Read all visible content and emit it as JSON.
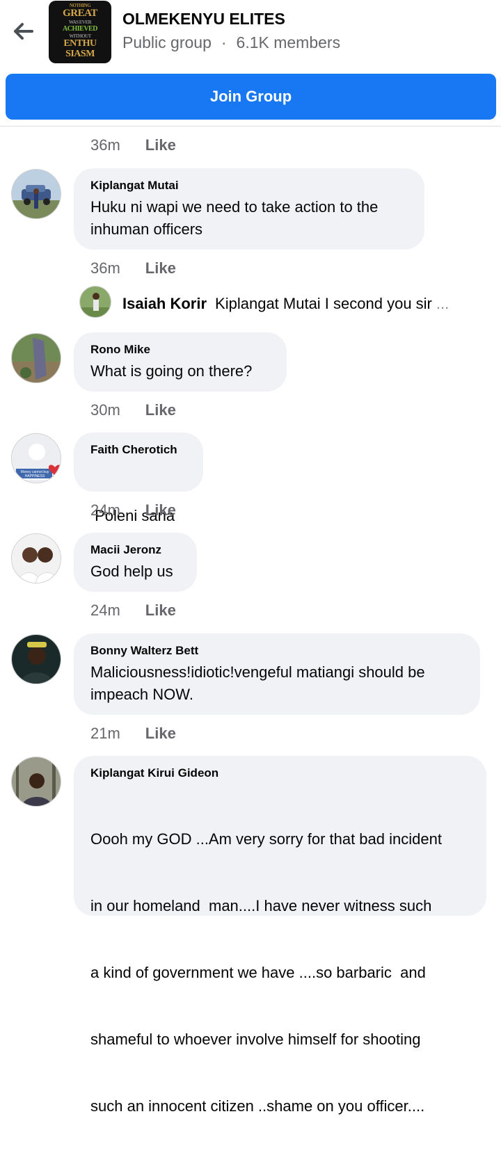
{
  "header": {
    "back_icon": "arrow-left-icon",
    "group_name": "OLMEKENYU ELITES",
    "privacy": "Public group",
    "separator": "·",
    "members": "6.1K members",
    "thumbnail_text": [
      "NOTHING",
      "GREAT",
      "WAS EVER",
      "ACHIEVED",
      "WITHOUT",
      "ENTHU",
      "SIASM"
    ]
  },
  "join_button": {
    "label": "Join Group",
    "color": "#1877f2"
  },
  "like_label": "Like",
  "top_meta": {
    "time": "36m"
  },
  "comments": [
    {
      "author": "Kiplangat Mutai",
      "lines": [
        "Huku ni wapi we need to take action to the",
        "inhuman officers"
      ],
      "time": "36m"
    },
    {
      "author": "Rono Mike",
      "lines": [
        "What is going on there?"
      ],
      "time": "30m"
    },
    {
      "author": "Faith Cherotich",
      "lines": [
        " Poleni sana"
      ],
      "time": "24m"
    },
    {
      "author": "Macii Jeronz",
      "lines": [
        "God help us"
      ],
      "time": "24m"
    },
    {
      "author": "Bonny Walterz Bett",
      "lines": [
        "Maliciousness!idiotic!vengeful matiangi should be",
        "impeach NOW."
      ],
      "time": "21m"
    },
    {
      "author": "Kiplangat Kirui Gideon",
      "lines": [
        "Oooh my GOD ...Am very sorry for that bad incident",
        "in our homeland  man....I have never witness such",
        "a kind of government we have ....so barbaric  and",
        "shameful to whoever involve himself for shooting",
        "such an innocent citizen ..shame on you officer...."
      ]
    }
  ],
  "reply": {
    "author": "Isaiah Korir",
    "text": "Kiplangat Mutai I second you sir",
    "ellipsis": "..."
  },
  "faith_avatar_caption": "Money cannot buy HAPPINESS"
}
